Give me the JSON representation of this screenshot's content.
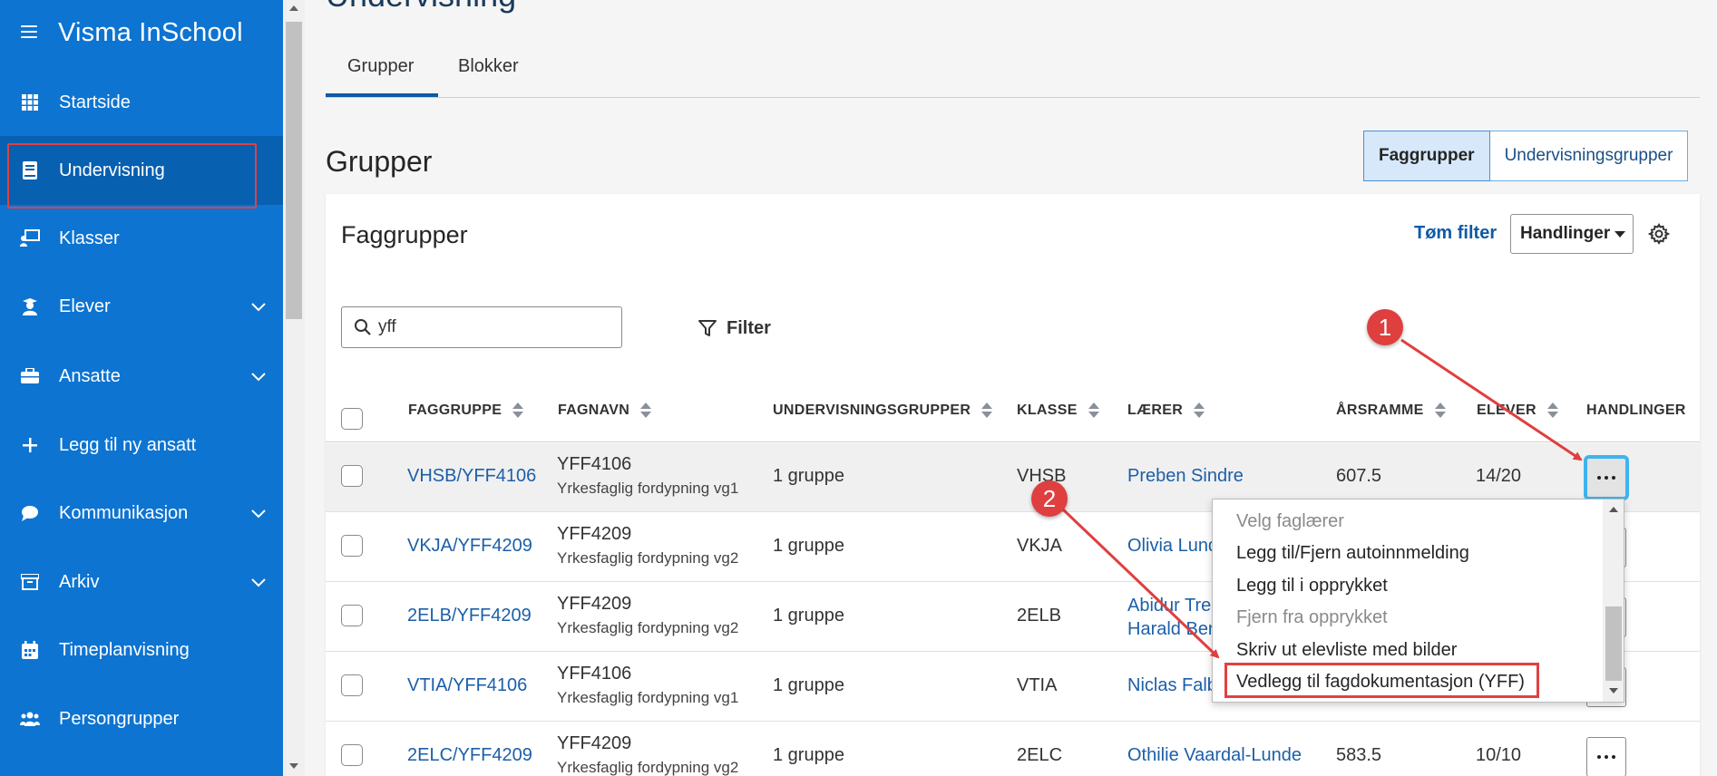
{
  "app": {
    "brand": "Visma InSchool"
  },
  "colors": {
    "sidebar": "#0d74d1",
    "sidebar_active": "#0760b0",
    "link": "#1c5fa8",
    "annotation": "#df3f3f",
    "focus": "#3fb3ee"
  },
  "sidebar": {
    "items": [
      {
        "label": "Startside",
        "icon": "grid-icon"
      },
      {
        "label": "Undervisning",
        "icon": "book-icon"
      },
      {
        "label": "Klasser",
        "icon": "classroom-icon"
      },
      {
        "label": "Elever",
        "icon": "student-icon"
      },
      {
        "label": "Ansatte",
        "icon": "briefcase-icon"
      },
      {
        "label": "Legg til ny ansatt",
        "icon": "plus-icon"
      },
      {
        "label": "Kommunikasjon",
        "icon": "chat-icon"
      },
      {
        "label": "Arkiv",
        "icon": "archive-icon"
      },
      {
        "label": "Timeplanvisning",
        "icon": "calendar-icon"
      },
      {
        "label": "Persongrupper",
        "icon": "people-icon"
      }
    ]
  },
  "page": {
    "title": "Undervisning",
    "tabs": [
      {
        "label": "Grupper"
      },
      {
        "label": "Blokker"
      }
    ],
    "section_title": "Grupper",
    "segment": [
      {
        "label": "Faggrupper"
      },
      {
        "label": "Undervisningsgrupper"
      }
    ]
  },
  "card": {
    "title": "Faggrupper",
    "clear_filter": "Tøm filter",
    "actions_label": "Handlinger",
    "search_value": "yff",
    "filter_label": "Filter"
  },
  "table": {
    "headers": [
      "FAGGRUPPE",
      "FAGNAVN",
      "UNDERVISNINGSGRUPPER",
      "KLASSE",
      "LÆRER",
      "ÅRSRAMME",
      "ELEVER",
      "HANDLINGER"
    ],
    "rows": [
      {
        "group": "VHSB/YFF4106",
        "code": "YFF4106",
        "subject": "Yrkesfaglig fordypning vg1",
        "groups": "1 gruppe",
        "class": "VHSB",
        "teacher": "Preben Sindre",
        "teacher2": "",
        "hours": "607.5",
        "students": "14/20"
      },
      {
        "group": "VKJA/YFF4209",
        "code": "YFF4209",
        "subject": "Yrkesfaglig fordypning vg2",
        "groups": "1 gruppe",
        "class": "VKJA",
        "teacher": "Olivia Lund",
        "teacher2": "",
        "hours": "",
        "students": ""
      },
      {
        "group": "2ELB/YFF4209",
        "code": "YFF4209",
        "subject": "Yrkesfaglig fordypning vg2",
        "groups": "1 gruppe",
        "class": "2ELB",
        "teacher": "Abidur Tre",
        "teacher2": "Harald Ber",
        "hours": "",
        "students": ""
      },
      {
        "group": "VTIA/YFF4106",
        "code": "YFF4106",
        "subject": "Yrkesfaglig fordypning vg1",
        "groups": "1 gruppe",
        "class": "VTIA",
        "teacher": "Niclas Falb",
        "teacher2": "",
        "hours": "",
        "students": ""
      },
      {
        "group": "2ELC/YFF4209",
        "code": "YFF4209",
        "subject": "Yrkesfaglig fordypning vg2",
        "groups": "1 gruppe",
        "class": "2ELC",
        "teacher": "Othilie Vaardal-Lunde",
        "teacher2": "",
        "hours": "583.5",
        "students": "10/10"
      }
    ]
  },
  "menu": {
    "items": [
      {
        "label": "Velg faglærer",
        "disabled": true
      },
      {
        "label": "Legg til/Fjern autoinnmelding",
        "disabled": false
      },
      {
        "label": "Legg til i opprykket",
        "disabled": false
      },
      {
        "label": "Fjern fra opprykket",
        "disabled": true
      },
      {
        "label": "Skriv ut elevliste med bilder",
        "disabled": false
      },
      {
        "label": "Vedlegg til fagdokumentasjon (YFF)",
        "disabled": false
      }
    ]
  },
  "annotations": [
    {
      "label": "1"
    },
    {
      "label": "2"
    }
  ]
}
